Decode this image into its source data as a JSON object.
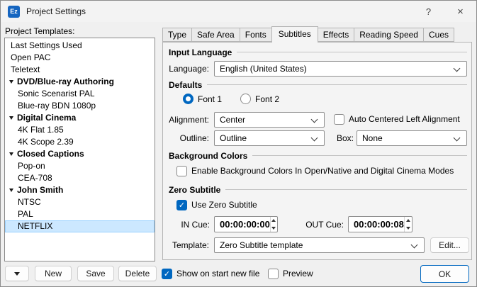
{
  "window": {
    "title": "Project Settings",
    "icon_text": "Ez",
    "help_glyph": "?",
    "close_glyph": "×"
  },
  "templates": {
    "label": "Project Templates:",
    "items": [
      {
        "label": "Last Settings Used",
        "type": "item"
      },
      {
        "label": "Open PAC",
        "type": "item"
      },
      {
        "label": "Teletext",
        "type": "item"
      },
      {
        "label": "DVD/Blue-ray Authoring",
        "type": "group"
      },
      {
        "label": "Sonic Scenarist PAL",
        "type": "child"
      },
      {
        "label": "Blue-ray BDN 1080p",
        "type": "child"
      },
      {
        "label": "Digital Cinema",
        "type": "group"
      },
      {
        "label": "4K Flat 1.85",
        "type": "child"
      },
      {
        "label": "4K Scope 2.39",
        "type": "child"
      },
      {
        "label": "Closed Captions",
        "type": "group"
      },
      {
        "label": "Pop-on",
        "type": "child"
      },
      {
        "label": "CEA-708",
        "type": "child"
      },
      {
        "label": "John Smith",
        "type": "group"
      },
      {
        "label": "NTSC",
        "type": "child"
      },
      {
        "label": "PAL",
        "type": "child"
      },
      {
        "label": "NETFLIX",
        "type": "child",
        "selected": true
      }
    ]
  },
  "tabs": {
    "items": [
      "Type",
      "Safe Area",
      "Fonts",
      "Subtitles",
      "Effects",
      "Reading Speed",
      "Cues"
    ],
    "active": "Subtitles"
  },
  "input_language": {
    "title": "Input Language",
    "language_label": "Language:",
    "language_value": "English (United States)"
  },
  "defaults": {
    "title": "Defaults",
    "font1_label": "Font 1",
    "font2_label": "Font 2",
    "font_selected": "Font 1",
    "alignment_label": "Alignment:",
    "alignment_value": "Center",
    "auto_centered_label": "Auto Centered Left Alignment",
    "auto_centered_checked": false,
    "outline_label": "Outline:",
    "outline_value": "Outline",
    "box_label": "Box:",
    "box_value": "None"
  },
  "background_colors": {
    "title": "Background Colors",
    "enable_label": "Enable Background Colors In Open/Native and Digital Cinema Modes",
    "enable_checked": false
  },
  "zero_subtitle": {
    "title": "Zero Subtitle",
    "use_label": "Use Zero Subtitle",
    "use_checked": true,
    "in_cue_label": "IN Cue:",
    "in_cue_value": "00:00:00:00",
    "out_cue_label": "OUT Cue:",
    "out_cue_value": "00:00:00:08",
    "template_label": "Template:",
    "template_value": "Zero Subtitle template",
    "edit_label": "Edit..."
  },
  "footer": {
    "new_label": "New",
    "save_label": "Save",
    "delete_label": "Delete",
    "show_on_start_label": "Show on start new file",
    "show_on_start_checked": true,
    "preview_label": "Preview",
    "preview_checked": false,
    "ok_label": "OK"
  },
  "colors": {
    "accent": "#0067c0",
    "selection": "#cce8ff"
  }
}
